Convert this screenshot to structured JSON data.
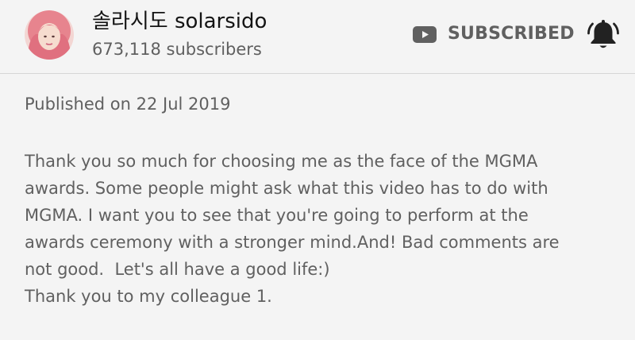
{
  "channel": {
    "name": "솔라시도 solarsido",
    "subscribers": "673,118 subscribers",
    "avatar_icon": "channel-avatar"
  },
  "subscribe": {
    "label": "SUBSCRIBED",
    "icon": "youtube-play-icon",
    "bell_icon": "notification-bell-icon"
  },
  "video": {
    "published": "Published on 22 Jul 2019",
    "description_lines": [
      "Thank you so much for choosing me as the face of the MGMA",
      "awards. Some people might ask what this video has to do with",
      "MGMA. I want you to see that you're going to perform at the",
      "awards ceremony with a stronger mind.And! Bad comments are",
      "not good.  Let's all have a good life:)",
      "Thank you to my colleague 1."
    ]
  },
  "colors": {
    "background": "#f4f4f4",
    "secondary_text": "#606060",
    "primary_text": "#141414",
    "divider": "#d6d6d6"
  }
}
